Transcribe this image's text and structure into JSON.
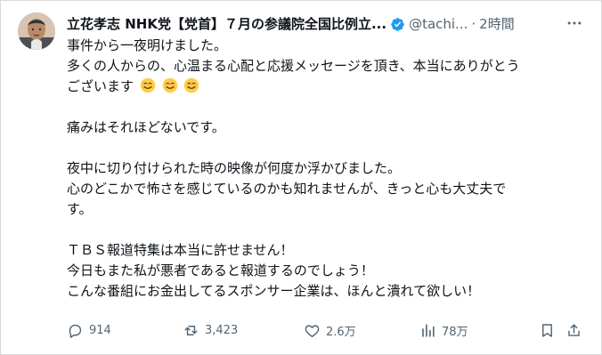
{
  "tweet": {
    "author": {
      "display_name": "立花孝志 NHK党【党首】７月の参議院全国比例立...",
      "handle": "@tachi...",
      "separator": "·",
      "time": "2時間"
    },
    "body": {
      "line1": "事件から一夜明けました。",
      "line2": "多くの人からの、心温まる心配と応援メッセージを頂き、本当にありがとう",
      "line3": "ございます",
      "line4": "痛みはそれほどないです。",
      "line5": "夜中に切り付けられた時の映像が何度か浮かびました。",
      "line6": "心のどこかで怖さを感じているのかも知れませんが、きっと心も大丈夫で",
      "line7": "す。",
      "line8": "ＴＢＳ報道特集は本当に許せません！",
      "line9": "今日もまた私が悪者であると報道するのでしょう！",
      "line10": "こんな番組にお金出してるスポンサー企業は、ほんと潰れて欲しい！"
    },
    "stats": {
      "replies": "914",
      "reposts": "3,423",
      "likes": "2.6万",
      "views": "78万"
    }
  },
  "icons": {
    "avatar": "profile-photo",
    "verified": "verified-badge-icon",
    "more": "more-icon",
    "emoji": "smiling-face-emoji",
    "reply": "reply-icon",
    "repost": "repost-icon",
    "like": "heart-icon",
    "views": "views-chart-icon",
    "bookmark": "bookmark-icon",
    "share": "share-icon"
  },
  "colors": {
    "text": "#0f1419",
    "muted": "#536471",
    "verified": "#1d9bf0"
  }
}
